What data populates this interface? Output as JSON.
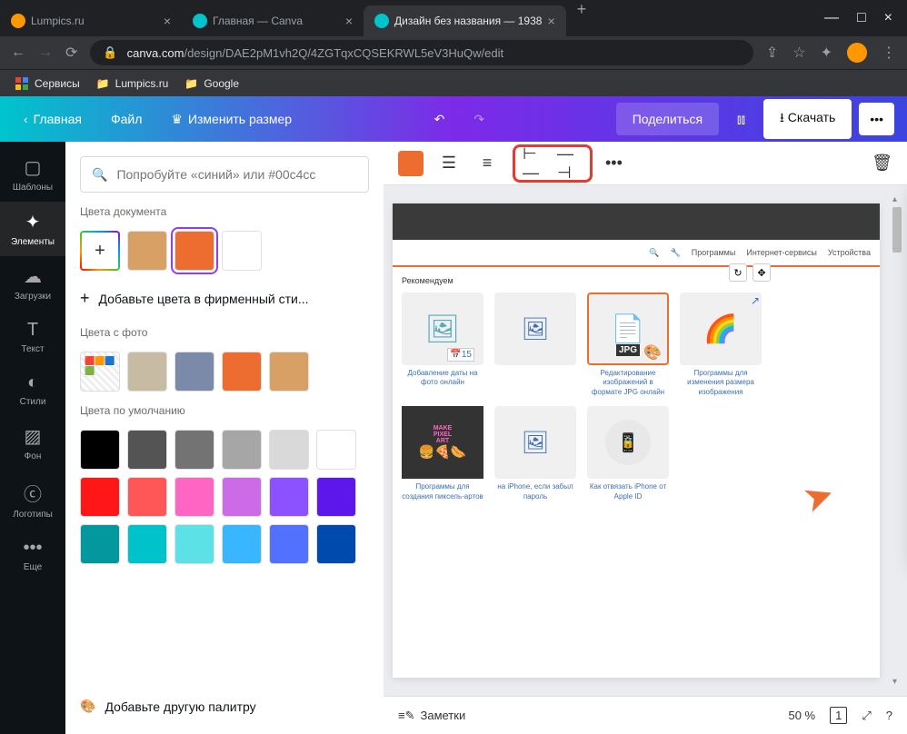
{
  "browser": {
    "tabs": [
      {
        "title": "Lumpics.ru",
        "favicon": "#ff9800"
      },
      {
        "title": "Главная — Canva",
        "favicon": "#00c4cc"
      },
      {
        "title": "Дизайн без названия — 1938",
        "favicon": "#00c4cc",
        "active": true
      }
    ],
    "url_domain": "canva.com",
    "url_path": "/design/DAE2pM1vh2Q/4ZGTqxCQSEKRWL5eV3HuQw/edit",
    "bookmarks": [
      {
        "label": "Сервисы",
        "color": ""
      },
      {
        "label": "Lumpics.ru",
        "color": "#ffc107"
      },
      {
        "label": "Google",
        "color": "#ffc107"
      }
    ]
  },
  "header": {
    "home": "Главная",
    "file": "Файл",
    "resize": "Изменить размер",
    "share": "Поделиться",
    "download": "Скачать"
  },
  "rail": {
    "templates": "Шаблоны",
    "elements": "Элементы",
    "uploads": "Загрузки",
    "text": "Текст",
    "styles": "Стили",
    "background": "Фон",
    "logos": "Логотипы",
    "more": "Еще"
  },
  "panel": {
    "search_placeholder": "Попробуйте «синий» или #00c4cc",
    "doc_colors_title": "Цвета документа",
    "doc_colors": [
      "#d9a066",
      "#ed6c30",
      "#ffffff"
    ],
    "add_brand": "Добавьте цвета в фирменный сти...",
    "photo_colors_title": "Цвета с фото",
    "photo_colors": [
      "#f5f5f5",
      "#c7bca3",
      "#7a8aa8",
      "#ed6c30",
      "#d9a066"
    ],
    "default_colors_title": "Цвета по умолчанию",
    "default_colors": [
      "#000000",
      "#545454",
      "#737373",
      "#a6a6a6",
      "#d9d9d9",
      "#ffffff",
      "#ff1616",
      "#ff5757",
      "#ff66c4",
      "#cb6ce6",
      "#8c52ff",
      "#5e17eb",
      "#03989e",
      "#00c2cb",
      "#5ce1e6",
      "#38b6ff",
      "#5271ff",
      "#004aad"
    ],
    "add_palette": "Добавьте другую палитру"
  },
  "canvas": {
    "nav_items": [
      "Программы",
      "Интернет-сервисы",
      "Устройства"
    ],
    "recommend": "Рекомендуем",
    "cards": [
      {
        "text": "Добавление даты на фото онлайн"
      },
      {
        "text": ""
      },
      {
        "text": "Редактирование изображений в формате JPG онлайн",
        "highlighted": true
      },
      {
        "text": "Программы для изменения размера изображения"
      }
    ],
    "cards2": [
      {
        "text": "Программы для создания пиксель-артов"
      },
      {
        "text": "на iPhone, если забыл пароль"
      },
      {
        "text": "Как отвязать iPhone от Apple ID"
      }
    ]
  },
  "footer": {
    "notes": "Заметки",
    "zoom": "50 %",
    "page": "1"
  }
}
